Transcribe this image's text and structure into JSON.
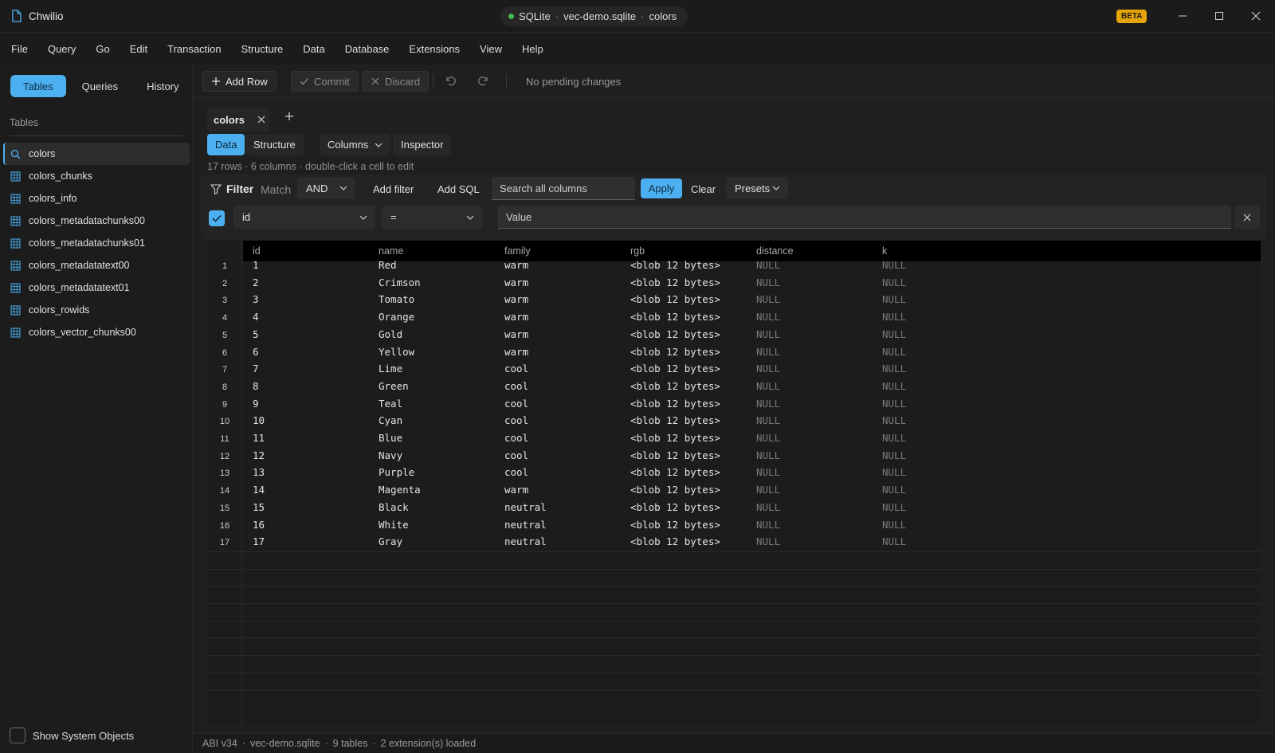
{
  "window": {
    "app_name": "Chwilio",
    "db_engine": "SQLite",
    "db_file": "vec-demo.sqlite",
    "table": "colors",
    "beta_badge": "BETA",
    "separator": "·"
  },
  "menu": [
    "File",
    "Query",
    "Go",
    "Edit",
    "Transaction",
    "Structure",
    "Data",
    "Database",
    "Extensions",
    "View",
    "Help"
  ],
  "sidebar": {
    "tabs": [
      "Tables",
      "Queries",
      "History"
    ],
    "heading": "Tables",
    "items": [
      {
        "label": "colors",
        "icon": "search-icon"
      },
      {
        "label": "colors_chunks",
        "icon": "table-icon"
      },
      {
        "label": "colors_info",
        "icon": "table-icon"
      },
      {
        "label": "colors_metadatachunks00",
        "icon": "table-icon"
      },
      {
        "label": "colors_metadatachunks01",
        "icon": "table-icon"
      },
      {
        "label": "colors_metadatatext00",
        "icon": "table-icon"
      },
      {
        "label": "colors_metadatatext01",
        "icon": "table-icon"
      },
      {
        "label": "colors_rowids",
        "icon": "table-icon"
      },
      {
        "label": "colors_vector_chunks00",
        "icon": "table-icon"
      }
    ],
    "show_system": "Show System Objects"
  },
  "toolbar": {
    "add_row": "Add Row",
    "commit": "Commit",
    "discard": "Discard",
    "pending": "No pending changes"
  },
  "doc_tab": "colors",
  "views": {
    "data": "Data",
    "structure": "Structure",
    "columns": "Columns",
    "inspector": "Inspector"
  },
  "meta": {
    "rows": "17 rows",
    "cols": "6 columns",
    "hint": "double-click a cell to edit"
  },
  "filter": {
    "label": "Filter",
    "match": "Match",
    "combinator": "AND",
    "add_filter": "Add filter",
    "add_sql": "Add SQL",
    "search_placeholder": "Search all columns",
    "apply": "Apply",
    "clear": "Clear",
    "presets": "Presets",
    "row_column": "id",
    "row_operator": "=",
    "row_value_placeholder": "Value"
  },
  "grid": {
    "columns": [
      "id",
      "name",
      "family",
      "rgb",
      "distance",
      "k"
    ],
    "rows": [
      [
        "1",
        "Red",
        "warm",
        "<blob 12 bytes>",
        "NULL",
        "NULL"
      ],
      [
        "2",
        "Crimson",
        "warm",
        "<blob 12 bytes>",
        "NULL",
        "NULL"
      ],
      [
        "3",
        "Tomato",
        "warm",
        "<blob 12 bytes>",
        "NULL",
        "NULL"
      ],
      [
        "4",
        "Orange",
        "warm",
        "<blob 12 bytes>",
        "NULL",
        "NULL"
      ],
      [
        "5",
        "Gold",
        "warm",
        "<blob 12 bytes>",
        "NULL",
        "NULL"
      ],
      [
        "6",
        "Yellow",
        "warm",
        "<blob 12 bytes>",
        "NULL",
        "NULL"
      ],
      [
        "7",
        "Lime",
        "cool",
        "<blob 12 bytes>",
        "NULL",
        "NULL"
      ],
      [
        "8",
        "Green",
        "cool",
        "<blob 12 bytes>",
        "NULL",
        "NULL"
      ],
      [
        "9",
        "Teal",
        "cool",
        "<blob 12 bytes>",
        "NULL",
        "NULL"
      ],
      [
        "10",
        "Cyan",
        "cool",
        "<blob 12 bytes>",
        "NULL",
        "NULL"
      ],
      [
        "11",
        "Blue",
        "cool",
        "<blob 12 bytes>",
        "NULL",
        "NULL"
      ],
      [
        "12",
        "Navy",
        "cool",
        "<blob 12 bytes>",
        "NULL",
        "NULL"
      ],
      [
        "13",
        "Purple",
        "cool",
        "<blob 12 bytes>",
        "NULL",
        "NULL"
      ],
      [
        "14",
        "Magenta",
        "warm",
        "<blob 12 bytes>",
        "NULL",
        "NULL"
      ],
      [
        "15",
        "Black",
        "neutral",
        "<blob 12 bytes>",
        "NULL",
        "NULL"
      ],
      [
        "16",
        "White",
        "neutral",
        "<blob 12 bytes>",
        "NULL",
        "NULL"
      ],
      [
        "17",
        "Gray",
        "neutral",
        "<blob 12 bytes>",
        "NULL",
        "NULL"
      ]
    ]
  },
  "status": {
    "abi": "ABI v34",
    "file": "vec-demo.sqlite",
    "tables": "9 tables",
    "extensions": "2 extension(s) loaded"
  },
  "colors": {
    "accent": "#4cb0f0",
    "beta": "#e5a50a",
    "connected": "#3fb950"
  }
}
